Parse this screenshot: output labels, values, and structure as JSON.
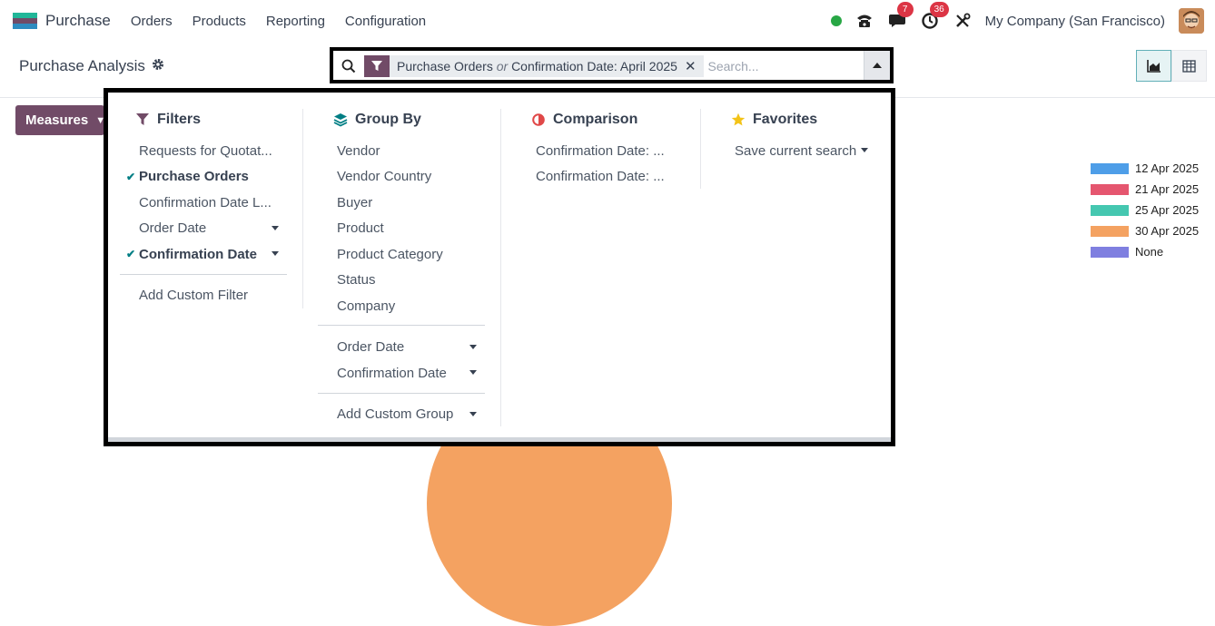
{
  "topbar": {
    "app_name": "Purchase",
    "nav": [
      "Orders",
      "Products",
      "Reporting",
      "Configuration"
    ],
    "messages_count": "7",
    "activities_count": "36",
    "company": "My Company (San Francisco)"
  },
  "control": {
    "title": "Purchase Analysis",
    "facet_part1": "Purchase Orders",
    "facet_or": "or",
    "facet_part2": "Confirmation Date: April 2025",
    "search_placeholder": "Search..."
  },
  "measures_label": "Measures",
  "legend": [
    {
      "label": "12 Apr 2025",
      "color": "#4e9ee8"
    },
    {
      "label": "21 Apr 2025",
      "color": "#e5566f"
    },
    {
      "label": "25 Apr 2025",
      "color": "#45c7b0"
    },
    {
      "label": "30 Apr 2025",
      "color": "#f4a261"
    },
    {
      "label": "None",
      "color": "#7f7fe0"
    }
  ],
  "filters": {
    "title": "Filters",
    "items": [
      "Requests for Quotat...",
      "Purchase Orders",
      "Confirmation Date L...",
      "Order Date",
      "Confirmation Date"
    ],
    "add_custom": "Add Custom Filter"
  },
  "groupby": {
    "title": "Group By",
    "items": [
      "Vendor",
      "Vendor Country",
      "Buyer",
      "Product",
      "Product Category",
      "Status",
      "Company"
    ],
    "date_items": [
      "Order Date",
      "Confirmation Date"
    ],
    "add_custom": "Add Custom Group"
  },
  "comparison": {
    "title": "Comparison",
    "items": [
      "Confirmation Date: ...",
      "Confirmation Date: ..."
    ]
  },
  "favorites": {
    "title": "Favorites",
    "save_current": "Save current search"
  },
  "colors": {
    "brand": "#714b67",
    "teal": "#017e84"
  }
}
